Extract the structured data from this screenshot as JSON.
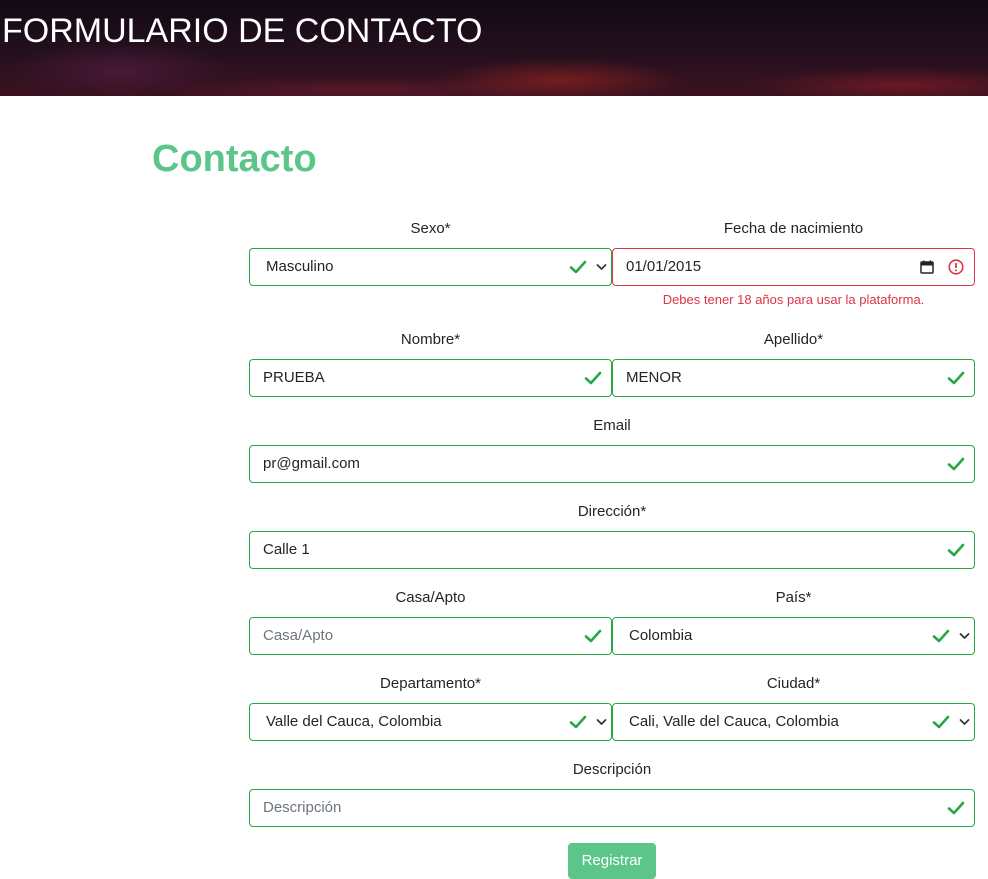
{
  "header": {
    "title": "FORMULARIO DE CONTACTO"
  },
  "page": {
    "title": "Contacto"
  },
  "form": {
    "sexo": {
      "label": "Sexo*",
      "value": "Masculino"
    },
    "fecha": {
      "label": "Fecha de nacimiento",
      "value": "01/01/2015",
      "error": "Debes tener 18 años para usar la plataforma."
    },
    "nombre": {
      "label": "Nombre*",
      "value": "PRUEBA"
    },
    "apellido": {
      "label": "Apellido*",
      "value": "MENOR"
    },
    "email": {
      "label": "Email",
      "value": "pr@gmail.com"
    },
    "direccion": {
      "label": "Dirección*",
      "value": "Calle 1"
    },
    "casa": {
      "label": "Casa/Apto",
      "placeholder": "Casa/Apto"
    },
    "pais": {
      "label": "País*",
      "value": "Colombia"
    },
    "departamento": {
      "label": "Departamento*",
      "value": "Valle del Cauca, Colombia"
    },
    "ciudad": {
      "label": "Ciudad*",
      "value": "Cali, Valle del Cauca, Colombia"
    },
    "descripcion": {
      "label": "Descripción",
      "placeholder": "Descripción"
    },
    "submit_label": "Registrar"
  },
  "colors": {
    "accent": "#5cc58a",
    "valid": "#28a745",
    "invalid": "#dc3545"
  },
  "icons": {
    "valid": "check-icon",
    "invalid": "exclamation-circle-icon",
    "date": "calendar-icon",
    "select": "chevron-down-icon"
  }
}
